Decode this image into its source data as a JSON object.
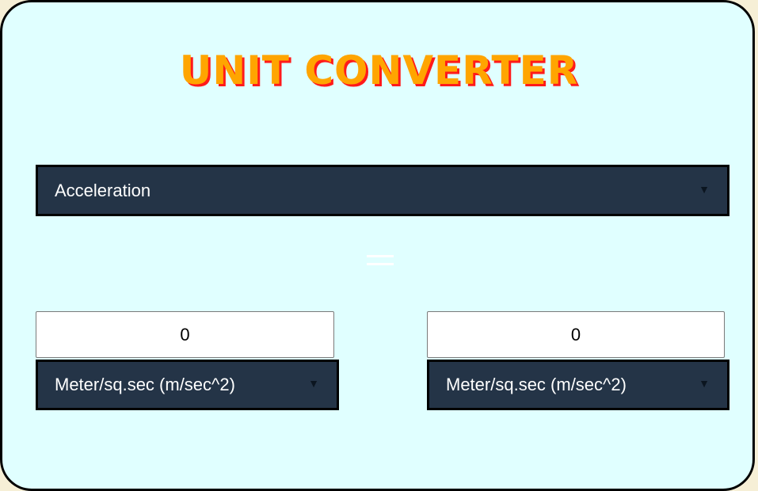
{
  "title": "UNIT CONVERTER",
  "category": {
    "selected": "Acceleration",
    "icon": "chevron-down-icon"
  },
  "equals_sign": "=",
  "from": {
    "value": "0",
    "unit": "Meter/sq.sec (m/sec^2)"
  },
  "to": {
    "value": "0",
    "unit": "Meter/sq.sec (m/sec^2)"
  },
  "colors": {
    "background": "#e0ffff",
    "select_background": "#243447",
    "title_fill": "#ffa500",
    "title_shadow": "#ff1a1a"
  }
}
